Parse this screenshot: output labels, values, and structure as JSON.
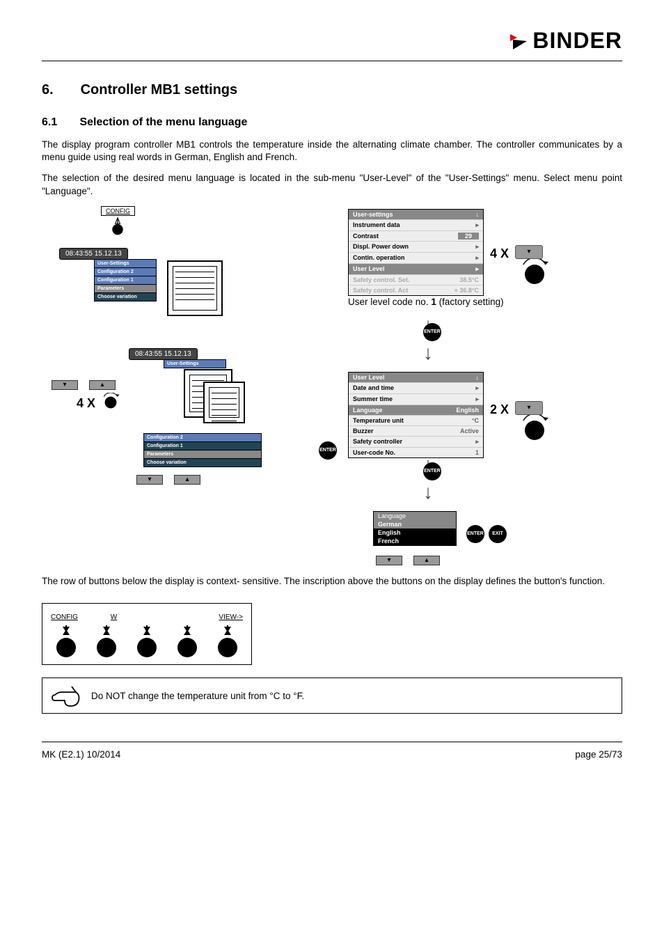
{
  "brand": "BINDER",
  "section_number": "6.",
  "section_title": "Controller MB1 settings",
  "subsection_number": "6.1",
  "subsection_title": "Selection of the menu language",
  "para1": "The display program controller MB1 controls the temperature inside the alternating climate chamber. The controller communicates by a menu guide using real words in German, English and French.",
  "para2": "The selection of the desired menu language is located in the sub-menu \"User-Level\" of the \"User-Settings\" menu. Select menu point \"Language\".",
  "para3": "The row of buttons below the display is context- sensitive. The inscription above the buttons on the display defines the button's function.",
  "callout": "Do NOT change the temperature unit from °C to °F.",
  "footer_left": "MK (E2.1) 10/2014",
  "footer_right": "page 25/73",
  "lcd_time": "08:43:55  15.12.13",
  "config_label": "CONFIG",
  "stack": {
    "user_settings": "User-Settings",
    "config2": "Configuration 2",
    "config1": "Configuration 1",
    "parameters": "Parameters",
    "choose_var": "Choose variation"
  },
  "x4": "4 X",
  "x2": "2 X",
  "factory_text_a": "User level code no. ",
  "factory_text_bold": "1",
  "factory_text_b": " (factory setting)",
  "menu1": {
    "title": "User-settings",
    "rows": [
      {
        "k": "Instrument data",
        "v": "▸"
      },
      {
        "k": "Contrast",
        "v": "29"
      },
      {
        "k": "Displ. Power down",
        "v": "▸"
      },
      {
        "k": "Contin. operation",
        "v": "▸"
      },
      {
        "k": "User Level",
        "v": "▸",
        "sel": true
      },
      {
        "k": "Safety control. Set.",
        "v": "38.5°C",
        "dim": true
      },
      {
        "k": "Safety control. Act",
        "v": "+ 36.8°C",
        "dim": true
      }
    ]
  },
  "menu2": {
    "title": "User Level",
    "rows": [
      {
        "k": "Date and time",
        "v": "▸"
      },
      {
        "k": "Summer time",
        "v": "▸"
      },
      {
        "k": "Language",
        "v": "English",
        "sel": true
      },
      {
        "k": "Temperature unit",
        "v": "°C"
      },
      {
        "k": "Buzzer",
        "v": "Active"
      },
      {
        "k": "Safety controller",
        "v": "▸"
      },
      {
        "k": "User-code No.",
        "v": "1"
      }
    ]
  },
  "menu3": {
    "title": "Language",
    "rows": [
      "German",
      "English",
      "French"
    ]
  },
  "btn_enter": "ENTER",
  "btn_exit": "EXIT",
  "ci_labels": {
    "config": "CONFIG",
    "w": "W",
    "view": "VIEW->"
  }
}
